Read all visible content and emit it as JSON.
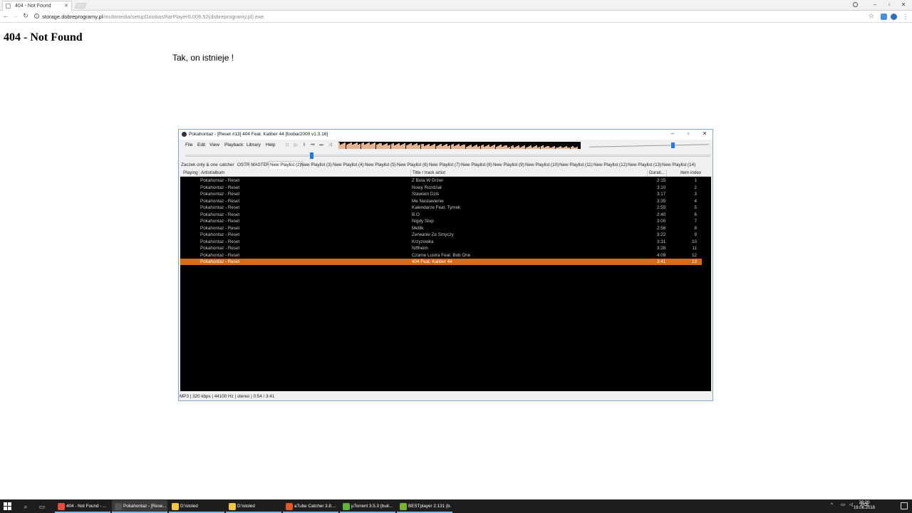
{
  "browser": {
    "tab_title": "404 - Not Found",
    "url_domain": "storage.dobreprogramy.pl",
    "url_path": "/multimedia/setupDziobasRarPlayer0.009.52(dobreprogramy.pl).exe"
  },
  "page": {
    "heading": "404 - Not Found",
    "text": "Tak, on istnieje !"
  },
  "foobar": {
    "title": "Pokahontaz - [Reset #13] 404 Feat. Kaliber 44  [foobar2000 v1.3.16]",
    "menu": [
      "File",
      "Edit",
      "View",
      "Playback",
      "Library",
      "Help"
    ],
    "tabs": [
      "Zaczek only & one",
      "catcher",
      "OSTR MASTER",
      "New Playlist (2)",
      "New Playlist (3)",
      "New Playlist (4)",
      "New Playlist (5)",
      "New Playlist (6)",
      "New Playlist (7)",
      "New Playlist (8)",
      "New Playlist (9)",
      "New Playlist (10)",
      "New Playlist (11)",
      "New Playlist (12)",
      "New Playlist (13)",
      "New Playlist (14)"
    ],
    "active_tab": 3,
    "columns": {
      "playing": "Playing",
      "artist_album": "Artist/album",
      "title": "Title / track artist",
      "duration": "Durati...",
      "index": "Item index"
    },
    "rows": [
      {
        "artist": "Pokahontaz - Reset",
        "title": "Z Buta W Drzwi",
        "duration": "2:15",
        "index": "1"
      },
      {
        "artist": "Pokahontaz - Reset",
        "title": "Nowy Rozdział",
        "duration": "3:10",
        "index": "2"
      },
      {
        "artist": "Pokahontaz - Reset",
        "title": "Stawiam Dziś",
        "duration": "3:17",
        "index": "3"
      },
      {
        "artist": "Pokahontaz - Reset",
        "title": "Me Nastawienie",
        "duration": "3:35",
        "index": "4"
      },
      {
        "artist": "Pokahontaz - Reset",
        "title": "Kalendarze Feat. Tymek",
        "duration": "2:55",
        "index": "5"
      },
      {
        "artist": "Pokahontaz - Reset",
        "title": "B.O",
        "duration": "2:40",
        "index": "6"
      },
      {
        "artist": "Pokahontaz - Reset",
        "title": "Nigdy Stop",
        "duration": "3:00",
        "index": "7"
      },
      {
        "artist": "Pokahontaz - Reset",
        "title": "Metlik",
        "duration": "2:56",
        "index": "8"
      },
      {
        "artist": "Pokahontaz - Reset",
        "title": "Zerwanie Ze Smyczy",
        "duration": "3:22",
        "index": "9"
      },
      {
        "artist": "Pokahontaz - Reset",
        "title": "Krzyzowka",
        "duration": "3:31",
        "index": "10"
      },
      {
        "artist": "Pokahontaz - Reset",
        "title": "Niflheim",
        "duration": "3:28",
        "index": "11"
      },
      {
        "artist": "Pokahontaz - Reset",
        "title": "Czarne Lustra Feat. Bob One",
        "duration": "4:09",
        "index": "12"
      },
      {
        "artist": "Pokahontaz - Reset",
        "title": "404 Feat. Kaliber 44",
        "duration": "3:41",
        "index": "13"
      }
    ],
    "selected_row": 12,
    "seek_fraction": 0.24,
    "volume_fraction": 0.7,
    "status": "MP3 | 320 kbps | 44100 Hz | stereo | 0:54 / 3:41",
    "colors": {
      "selection": "#d86a12",
      "list_bg": "#000000",
      "knob": "#1e7be0"
    }
  },
  "taskbar": {
    "items": [
      {
        "label": "404 - Not Found - ...",
        "icon": "chrome-icon",
        "color": "#e84c3d",
        "active": false
      },
      {
        "label": "Pokahontaz - [Rese...",
        "icon": "foobar-icon",
        "color": "#555555",
        "active": true
      },
      {
        "label": "D:\\stoled",
        "icon": "folder-icon",
        "color": "#f4c542",
        "active": false
      },
      {
        "label": "D:\\stoled",
        "icon": "folder-icon",
        "color": "#f4c542",
        "active": false
      },
      {
        "label": "aTube Catcher 3.8....",
        "icon": "atube-icon",
        "color": "#e2572b",
        "active": false
      },
      {
        "label": "µTorrent 3.5.3 (buil...",
        "icon": "utorrent-icon",
        "color": "#5fb336",
        "active": false
      },
      {
        "label": "BESTplayer 2.131 (b...",
        "icon": "bestplayer-icon",
        "color": "#7bb32e",
        "active": false
      }
    ],
    "lang": "POL",
    "time": "20:20",
    "date": "19.06.2018"
  }
}
